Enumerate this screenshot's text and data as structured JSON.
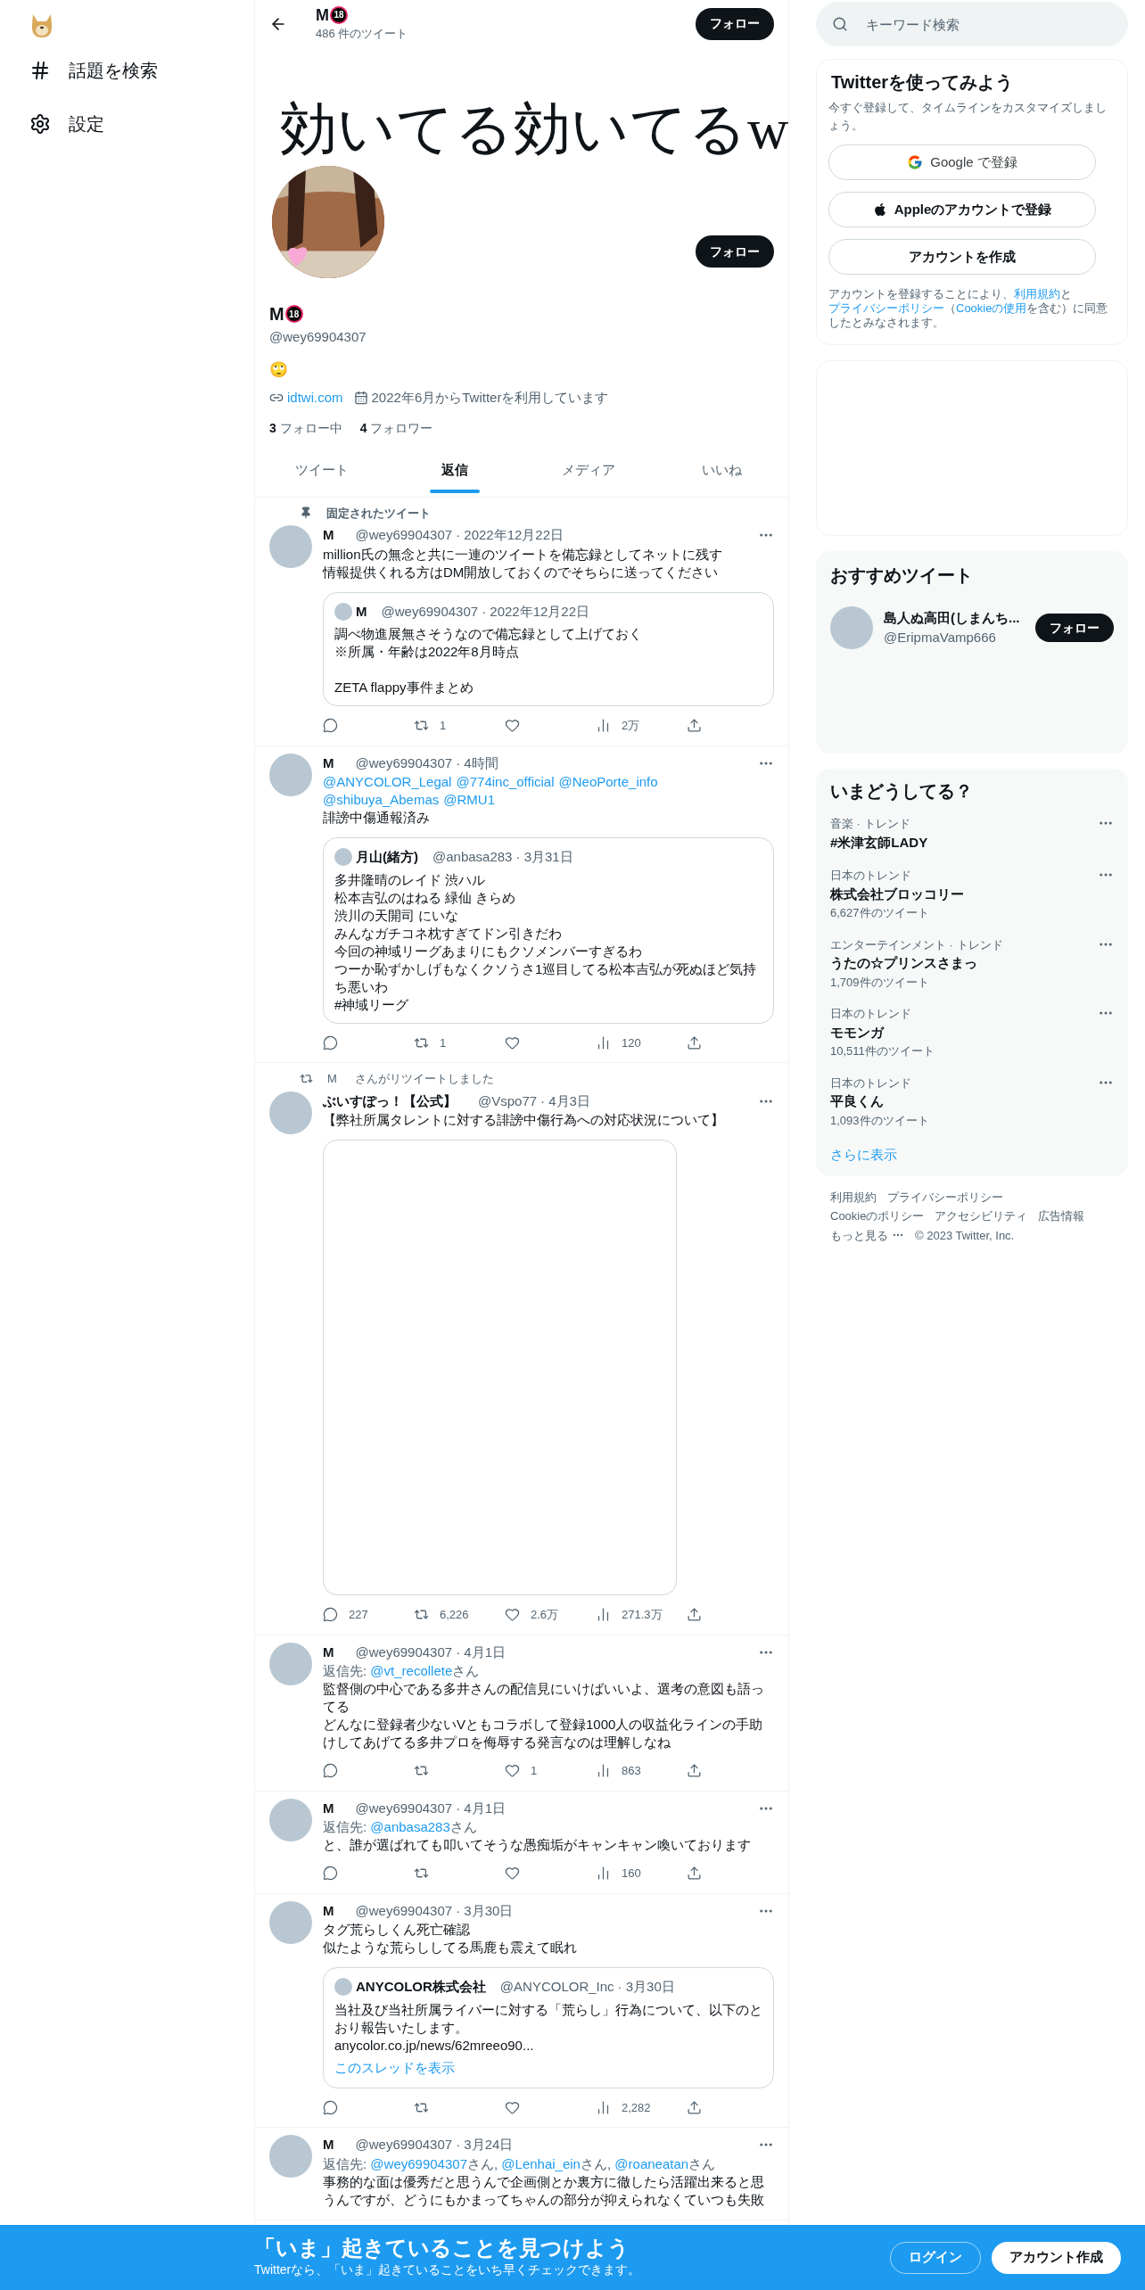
{
  "nav": {
    "items": [
      {
        "kind": "hash",
        "label": "話題を検索"
      },
      {
        "kind": "settings",
        "label": "設定"
      }
    ]
  },
  "header": {
    "name": "M",
    "badge": "18",
    "tweet_count": "486 件のツイート",
    "follow_button": "フォロー"
  },
  "banner": {
    "text": "効いてる効いてるw"
  },
  "profile": {
    "follow_button": "フォロー",
    "name": "M",
    "badge": "18",
    "handle": "@wey69904307",
    "bio": "🙄",
    "link": "idtwi.com",
    "joined": "2022年6月からTwitterを利用しています",
    "following_count": "3",
    "following_label": "フォロー中",
    "followers_count": "4",
    "followers_label": "フォロワー"
  },
  "tabs": [
    {
      "label": "ツイート",
      "selected": false
    },
    {
      "label": "返信",
      "selected": true
    },
    {
      "label": "メディア",
      "selected": false
    },
    {
      "label": "いいね",
      "selected": false
    }
  ],
  "tweets": [
    {
      "context": {
        "kind": "pinned",
        "text": "固定されたツイート"
      },
      "name": "M",
      "handle": "@wey69904307",
      "time": "· 2022年12月22日",
      "text": [
        [
          "million氏の無念と共に一連のツイートを備忘録としてネットに残す",
          "情報提供くれる方はDM開放しておくのでそちらに送ってください"
        ]
      ],
      "quote": {
        "name": "M",
        "handle": "@wey69904307",
        "time": "· 2022年12月22日",
        "text": [
          [
            "調べ物進展無さそうなので備忘録として上げておく",
            "※所属・年齢は2022年8月時点"
          ],
          [
            "ZETA flappy事件まとめ"
          ]
        ]
      },
      "stats": {
        "retweets": "1",
        "views": "2万"
      }
    },
    {
      "name": "M",
      "handle": "@wey69904307",
      "time": "· 4時間",
      "mentions": [
        "@ANYCOLOR_Legal",
        "@774inc_official",
        "@NeoPorte_info",
        "@shibuya_Abemas",
        "@RMU1"
      ],
      "text": [
        [
          "誹謗中傷通報済み"
        ]
      ],
      "quote": {
        "name": "月山(緒方)",
        "handle": "@anbasa283",
        "time": "· 3月31日",
        "text": [
          [
            "多井隆晴のレイド 渋ハル",
            "松本吉弘のはねる 緑仙 きらめ",
            "渋川の天開司 にいな",
            "みんなガチコネ枕すぎてドン引きだわ",
            "今回の神域リーグあまりにもクソメンバーすぎるわ",
            "つーか恥ずかしげもなくクソうさ1巡目してる松本吉弘が死ぬほど気持ち悪いわ",
            "#神域リーグ"
          ]
        ]
      },
      "stats": {
        "retweets": "1",
        "views": "120"
      }
    },
    {
      "context": {
        "kind": "retweet",
        "name": "M",
        "text": "さんがリツイートしました"
      },
      "name": "ぶいすぽっ！【公式】",
      "handle": "@Vspo77",
      "time": "· 4月3日",
      "text": [
        [
          "【弊社所属タレントに対する誹謗中傷行為への対応状況について】"
        ]
      ],
      "media": {
        "kind": "blank"
      },
      "stats": {
        "replies": "227",
        "retweets": "6,226",
        "likes": "2.6万",
        "views": "271.3万"
      }
    },
    {
      "name": "M",
      "handle": "@wey69904307",
      "time": "· 4月1日",
      "reply_label": "返信先:",
      "reply_to": [
        {
          "handle": "@vt_recollete",
          "suffix": "さん"
        }
      ],
      "text": [
        [
          "監督側の中心である多井さんの配信見にいけばいいよ、選考の意図も語ってる",
          "どんなに登録者少ないVともコラボして登録1000人の収益化ラインの手助けしてあげてる多井プロを侮辱する発言なのは理解しなね"
        ]
      ],
      "stats": {
        "likes": "1",
        "views": "863"
      }
    },
    {
      "name": "M",
      "handle": "@wey69904307",
      "time": "· 4月1日",
      "reply_label": "返信先:",
      "reply_to": [
        {
          "handle": "@anbasa283",
          "suffix": "さん"
        }
      ],
      "text": [
        [
          "と、誰が選ばれても叩いてそうな愚痴垢がキャンキャン喚いております"
        ]
      ],
      "stats": {
        "views": "160"
      }
    },
    {
      "name": "M",
      "handle": "@wey69904307",
      "time": "· 3月30日",
      "text": [
        [
          "タグ荒らしくん死亡確認",
          "似たような荒らししてる馬鹿も震えて眠れ"
        ]
      ],
      "quote": {
        "name": "ANYCOLOR株式会社",
        "handle": "@ANYCOLOR_Inc",
        "time": "· 3月30日",
        "text": [
          [
            "当社及び当社所属ライバーに対する「荒らし」行為について、以下のとおり報告いたします。",
            "anycolor.co.jp/news/62mreeo90..."
          ]
        ],
        "thread_link": "このスレッドを表示"
      },
      "stats": {
        "views": "2,282"
      }
    },
    {
      "name": "M",
      "handle": "@wey69904307",
      "time": "· 3月24日",
      "reply_label": "返信先:",
      "reply_to": [
        {
          "handle": "@wey69904307",
          "suffix": "さん, "
        },
        {
          "handle": "@Lenhai_ein",
          "suffix": "さん, "
        },
        {
          "handle": "@roaneatan",
          "suffix": "さん"
        }
      ],
      "text": [
        [
          "事務的な面は優秀だと思うんで企画側とか裏方に徹したら活躍出来ると思うんですが、どうにもかまってちゃんの部分が抑えられなくていつも失敗"
        ]
      ]
    }
  ],
  "sidebar": {
    "search": {
      "placeholder": "キーワード検索"
    },
    "signup": {
      "title": "Twitterを使ってみよう",
      "subtitle": "今すぐ登録して、タイムラインをカスタマイズしましょう。",
      "buttons": [
        {
          "kind": "google",
          "label": "Google で登録"
        },
        {
          "kind": "apple",
          "label": "Appleのアカウントで登録"
        },
        {
          "kind": "plain",
          "label": "アカウントを作成"
        }
      ],
      "legal": [
        {
          "text": "アカウントを登録することにより、"
        },
        {
          "text": "利用規約",
          "link": true
        },
        {
          "text": "と"
        },
        {
          "text": "プライバシーポリシー",
          "link": true
        },
        {
          "text": "（"
        },
        {
          "text": "Cookieの使用",
          "link": true
        },
        {
          "text": "を含む）に同意したとみなされます。"
        }
      ]
    },
    "recommended": {
      "title": "おすすめツイート",
      "users": [
        {
          "name": "島人ぬ高田(しまんち...",
          "handle": "@EripmaVamp666",
          "button": "フォロー"
        }
      ]
    },
    "trends": {
      "title": "いまどうしてる？",
      "items": [
        {
          "category": "音楽 · トレンド",
          "title": "#米津玄師LADY"
        },
        {
          "category": "日本のトレンド",
          "title": "株式会社ブロッコリー",
          "count": "6,627件のツイート"
        },
        {
          "category": "エンターテインメント · トレンド",
          "title": "うたの☆プリンスさまっ",
          "count": "1,709件のツイート"
        },
        {
          "category": "日本のトレンド",
          "title": "モモンガ",
          "count": "10,511件のツイート"
        },
        {
          "category": "日本のトレンド",
          "title": "平良くん",
          "count": "1,093件のツイート"
        }
      ],
      "more": "さらに表示"
    },
    "footer": {
      "links": [
        "利用規約",
        "プライバシーポリシー",
        "Cookieのポリシー",
        "アクセシビリティ",
        "広告情報",
        "もっと見る"
      ],
      "copyright": "© 2023 Twitter, Inc."
    }
  },
  "bottom_bar": {
    "title": "「いま」起きていることを見つけよう",
    "subtitle": "Twitterなら、「いま」起きていることをいち早くチェックできます。",
    "login": "ログイン",
    "signup": "アカウント作成"
  }
}
